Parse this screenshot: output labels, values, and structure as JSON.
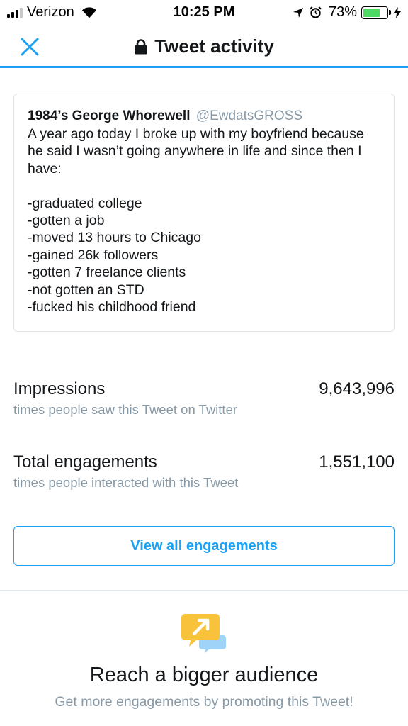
{
  "status_bar": {
    "carrier": "Verizon",
    "time": "10:25 PM",
    "battery": "73%",
    "battery_level": 0.73,
    "icons": [
      "signal-icon",
      "wifi-icon",
      "location-icon",
      "alarm-icon",
      "battery-icon",
      "charging-icon"
    ]
  },
  "header": {
    "title": "Tweet activity",
    "close_icon": "close-icon",
    "lock_icon": "lock-icon"
  },
  "tweet": {
    "name": "1984’s George Whorewell",
    "handle": "@EwdatsGROSS",
    "text": "A year ago today I broke up with my boyfriend because he said I wasn’t going anywhere in life and since then I have:\n\n-graduated college\n-gotten a job\n-moved 13 hours to Chicago\n-gained 26k followers\n-gotten 7 freelance clients\n-not gotten an STD\n-fucked his childhood friend"
  },
  "metrics": {
    "impressions": {
      "label": "Impressions",
      "value": "9,643,996",
      "description": "times people saw this Tweet on Twitter"
    },
    "engagements": {
      "label": "Total engagements",
      "value": "1,551,100",
      "description": "times people interacted with this Tweet"
    }
  },
  "actions": {
    "view_all": "View all engagements"
  },
  "promo": {
    "icon": "promote-icon",
    "title": "Reach a bigger audience",
    "subtitle": "Get more engagements by promoting this Tweet!"
  },
  "colors": {
    "accent": "#1da1f2",
    "secondary_text": "#8899a6",
    "battery_green": "#4cd964",
    "promo_yellow": "#f8c23a"
  }
}
